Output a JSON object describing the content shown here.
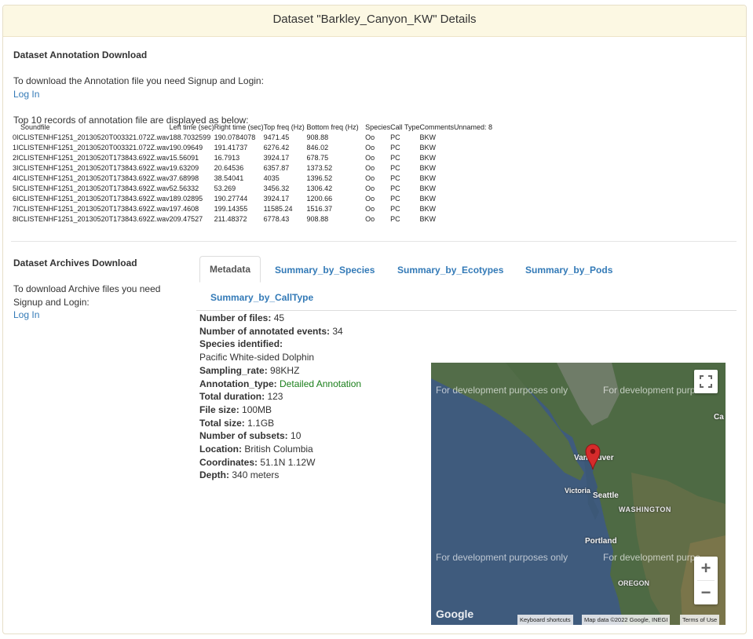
{
  "page": {
    "title": "Dataset \"Barkley_Canyon_KW\" Details"
  },
  "annotation": {
    "heading": "Dataset Annotation Download",
    "notice": "To download the Annotation file you need Signup and Login:",
    "login": "Log In",
    "top_records": "Top 10 records of annotation file are displayed as below:",
    "columns": [
      "",
      "Soundfile",
      "Left time (sec)",
      "Right time (sec)",
      "Top freq (Hz)",
      "Bottom freq (Hz)",
      "Species",
      "Call Type",
      "Comments",
      "Unnamed: 8"
    ],
    "rows": [
      [
        "0",
        "ICLISTENHF1251_20130520T003321.072Z.wav",
        "188.7032599",
        "190.0784078",
        "9471.45",
        "908.88",
        "Oo",
        "PC",
        "BKW",
        ""
      ],
      [
        "1",
        "ICLISTENHF1251_20130520T003321.072Z.wav",
        "190.09649",
        "191.41737",
        "6276.42",
        "846.02",
        "Oo",
        "PC",
        "BKW",
        ""
      ],
      [
        "2",
        "ICLISTENHF1251_20130520T173843.692Z.wav",
        "15.56091",
        "16.7913",
        "3924.17",
        "678.75",
        "Oo",
        "PC",
        "BKW",
        ""
      ],
      [
        "3",
        "ICLISTENHF1251_20130520T173843.692Z.wav",
        "19.63209",
        "20.64536",
        "6357.87",
        "1373.52",
        "Oo",
        "PC",
        "BKW",
        ""
      ],
      [
        "4",
        "ICLISTENHF1251_20130520T173843.692Z.wav",
        "37.68998",
        "38.54041",
        "4035",
        "1396.52",
        "Oo",
        "PC",
        "BKW",
        ""
      ],
      [
        "5",
        "ICLISTENHF1251_20130520T173843.692Z.wav",
        "52.56332",
        "53.269",
        "3456.32",
        "1306.42",
        "Oo",
        "PC",
        "BKW",
        ""
      ],
      [
        "6",
        "ICLISTENHF1251_20130520T173843.692Z.wav",
        "189.02895",
        "190.27744",
        "3924.17",
        "1200.66",
        "Oo",
        "PC",
        "BKW",
        ""
      ],
      [
        "7",
        "ICLISTENHF1251_20130520T173843.692Z.wav",
        "197.4608",
        "199.14355",
        "11585.24",
        "1516.37",
        "Oo",
        "PC",
        "BKW",
        ""
      ],
      [
        "8",
        "ICLISTENHF1251_20130520T173843.692Z.wav",
        "209.47527",
        "211.48372",
        "6778.43",
        "908.88",
        "Oo",
        "PC",
        "BKW",
        ""
      ]
    ]
  },
  "archives": {
    "heading": "Dataset Archives Download",
    "notice_line1": "To download Archive files you need",
    "notice_line2": "Signup and Login:",
    "login": "Log In"
  },
  "tabs": [
    "Metadata",
    "Summary_by_Species",
    "Summary_by_Ecotypes",
    "Summary_by_Pods",
    "Summary_by_CallType"
  ],
  "metadata": {
    "files_label": "Number of files:",
    "files": "45",
    "events_label": "Number of annotated events:",
    "events": "34",
    "species_label": "Species identified:",
    "species": "Pacific White-sided Dolphin",
    "sampling_label": "Sampling_rate:",
    "sampling": "98KHZ",
    "annotation_label": "Annotation_type:",
    "annotation": "Detailed Annotation",
    "duration_label": "Total duration:",
    "duration": "123",
    "filesize_label": "File size:",
    "filesize": "100MB",
    "totalsize_label": "Total size:",
    "totalsize": "1.1GB",
    "subsets_label": "Number of subsets:",
    "subsets": "10",
    "location_label": "Location:",
    "location": "British Columbia",
    "coords_label": "Coordinates:",
    "coords": "51.1N  1.12W",
    "depth_label": "Depth:",
    "depth": "340 meters"
  },
  "map": {
    "dev_notice": "For development purposes only",
    "dev_notice_right": "For development purpo",
    "labels": {
      "vancouver": "Vancouver",
      "victoria": "Victoria",
      "seattle": "Seattle",
      "washington": "WASHINGTON",
      "portland": "Portland",
      "oregon": "OREGON",
      "ca": "Ca"
    },
    "logo": "Google",
    "attribution": [
      "Keyboard shortcuts",
      "Map data ©2022 Google, INEGI",
      "Terms of Use"
    ],
    "zoom_in": "+",
    "zoom_out": "−",
    "colors": {
      "water": "#3d5a7a",
      "land": "#4f6b45",
      "marker": "#d62b2b"
    }
  }
}
